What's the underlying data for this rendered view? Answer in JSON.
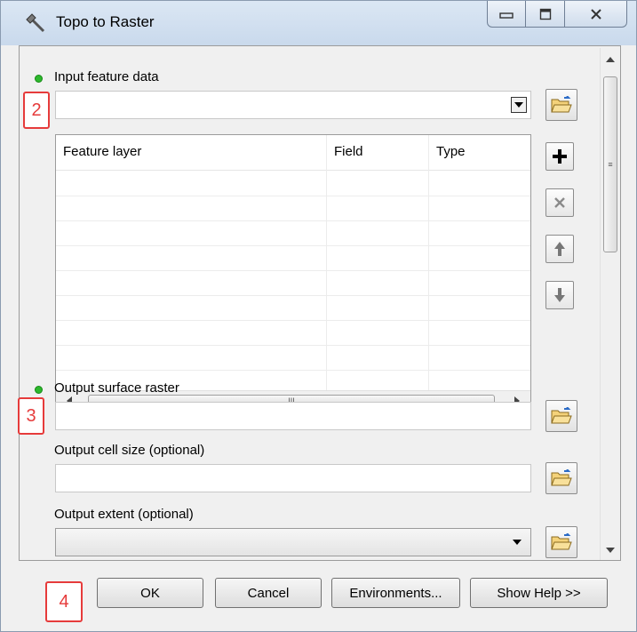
{
  "window": {
    "title": "Topo to Raster"
  },
  "fields": {
    "input_feature_data": {
      "label": "Input feature data",
      "value": ""
    },
    "table": {
      "columns": [
        "Feature layer",
        "Field",
        "Type"
      ],
      "rows": []
    },
    "output_surface_raster": {
      "label": "Output surface raster",
      "value": ""
    },
    "output_cell_size": {
      "label": "Output cell size (optional)",
      "value": ""
    },
    "output_extent": {
      "label": "Output extent (optional)",
      "value": ""
    }
  },
  "footer": {
    "ok_label": "OK",
    "cancel_label": "Cancel",
    "environments_label": "Environments...",
    "show_help_label": "Show Help >>"
  },
  "markers": {
    "m2": "2",
    "m3": "3",
    "m4": "4"
  },
  "colors": {
    "required_dot": "#2db82d",
    "marker": "#e63b3b"
  },
  "icons": [
    "hammer-icon",
    "minimize-icon",
    "maximize-icon",
    "close-icon",
    "folder-open-icon",
    "add-icon",
    "delete-icon",
    "move-up-icon",
    "move-down-icon",
    "dropdown-arrow-icon",
    "scroll-arrow-icon"
  ]
}
